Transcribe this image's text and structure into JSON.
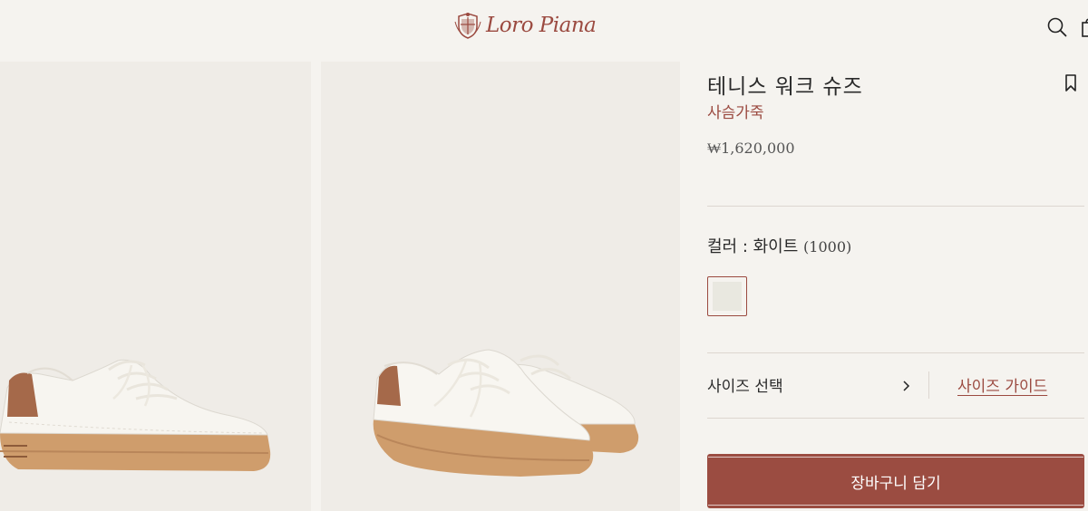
{
  "header": {
    "logo_text": "Loro Piana",
    "icons": [
      "search-icon",
      "shopping-bag-icon"
    ]
  },
  "product": {
    "title": "테니스 워크 슈즈",
    "material": "사슴가죽",
    "price": "₩1,620,000",
    "color_label": "컬러 : 화이트",
    "color_code": "(1000)",
    "swatch_color": "#e9e8e0",
    "size_select_label": "사이즈 선택",
    "size_guide_label": "사이즈 가이드",
    "add_to_cart_label": "장바구니 담기"
  },
  "colors": {
    "accent": "#9b4a40",
    "background": "#f5f3ef",
    "image_background": "#efece7",
    "cart_button": "#9b4c41"
  }
}
